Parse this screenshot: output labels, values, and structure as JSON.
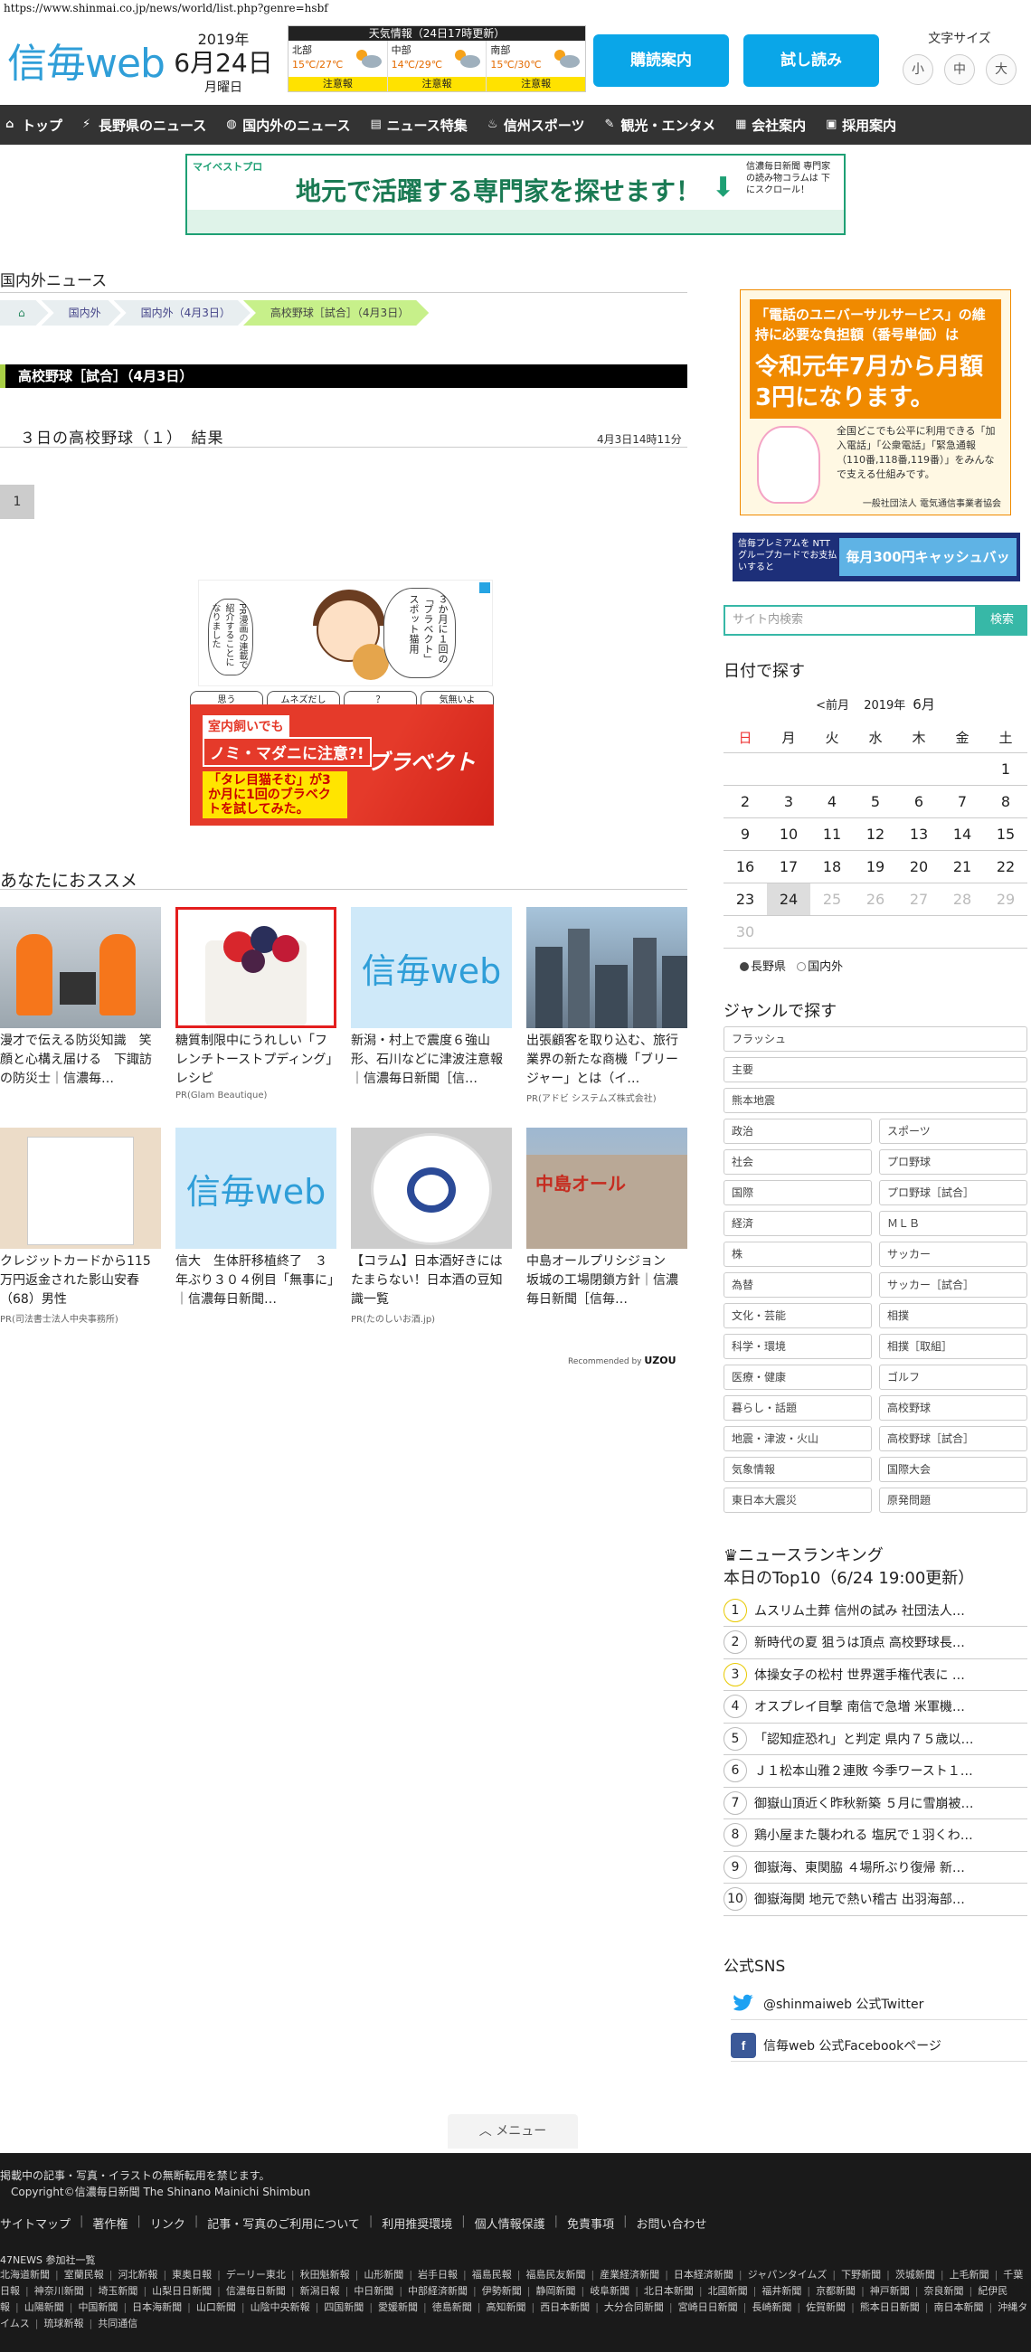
{
  "url": "https://www.shinmai.co.jp/news/world/list.php?genre=hsbf",
  "header": {
    "logo_text": "信毎web",
    "year": "2019年",
    "month_day": "6月24日",
    "weekday": "月曜日",
    "weather_title": "天気情報（24日17時更新）",
    "weather": [
      {
        "region": "北部",
        "temp": "15℃/27℃",
        "alert": "注意報"
      },
      {
        "region": "中部",
        "temp": "14℃/29℃",
        "alert": "注意報"
      },
      {
        "region": "南部",
        "temp": "15℃/30℃",
        "alert": "注意報"
      }
    ],
    "subscribe_label": "購読案内",
    "trial_label": "試し読み",
    "font_size_label": "文字サイズ",
    "font_small": "小",
    "font_medium": "中",
    "font_large": "大"
  },
  "nav": [
    {
      "icon": "home-icon",
      "glyph": "⌂",
      "label": "トップ"
    },
    {
      "icon": "lightning-icon",
      "glyph": "⚡",
      "label": "長野県のニュース"
    },
    {
      "icon": "globe-icon",
      "glyph": "◍",
      "label": "国内外のニュース"
    },
    {
      "icon": "document-icon",
      "glyph": "▤",
      "label": "ニュース特集"
    },
    {
      "icon": "sports-icon",
      "glyph": "♨",
      "label": "信州スポーツ"
    },
    {
      "icon": "tag-icon",
      "glyph": "✎",
      "label": "観光・エンタメ"
    },
    {
      "icon": "company-icon",
      "glyph": "▦",
      "label": "会社案内"
    },
    {
      "icon": "recruit-icon",
      "glyph": "▣",
      "label": "採用案内"
    }
  ],
  "top_banner": {
    "tag": "マイベストプロ",
    "headline": "地元で活躍する専門家を探せます！",
    "side": "信濃毎日新聞 専門家の読み物コラムは 下にスクロール！"
  },
  "main": {
    "section_title": "国内外ニュース",
    "breadcrumbs": [
      "国内外",
      "国内外（4月3日）",
      "高校野球［試合］（4月3日）"
    ],
    "category_bar": "高校野球［試合］（4月3日）",
    "article_title": "３日の高校野球（１）　結果",
    "article_time": "4月3日14時11分",
    "page": "1"
  },
  "ads": {
    "manga_right": "３か月に１回の「ブラベクト」スポット猫用",
    "manga_left": "PR漫画の連載で紹介することになりました",
    "strip": [
      "思う",
      "ムネズだし",
      "？",
      "気無いよ"
    ],
    "bravecto_1": "室内飼いでも",
    "bravecto_2": "ノミ・マダニに注意?!",
    "bravecto_3": "「タレ目猫そむ」が3か月に1回のブラベクトを試してみた。",
    "bravecto_logo": "ブラベクト"
  },
  "recommend": {
    "title": "あなたにおススメ",
    "cards": [
      {
        "text": "漫才で伝える防災知識　笑顔と心構え届ける　下諏訪の防災士｜信濃毎…",
        "pr": ""
      },
      {
        "text": "糖質制限中にうれしい「フレンチトーストプディング」レシピ",
        "pr": "PR(Glam Beautique)"
      },
      {
        "text": "新潟・村上で震度６強山形、石川などに津波注意報｜信濃毎日新聞［信…",
        "pr": ""
      },
      {
        "text": "出張顧客を取り込む、旅行業界の新たな商機「ブリージャー」とは（イ…",
        "pr": "PR(アドビ システムズ株式会社)"
      },
      {
        "text": "クレジットカードから115万円返金された影山安春（68）男性",
        "pr": "PR(司法書士法人中央事務所)"
      },
      {
        "text": "信大　生体肝移植終了　３年ぶり３０４例目「無事に」｜信濃毎日新聞…",
        "pr": ""
      },
      {
        "text": "【コラム】日本酒好きにはたまらない！日本酒の豆知識一覧",
        "pr": "PR(たのしいお酒.jp)"
      },
      {
        "text": "中島オールプリシジョン　坂城の工場閉鎖方針｜信濃毎日新聞［信毎…",
        "pr": ""
      }
    ],
    "sign_logo": "信毎web",
    "building_sign": "中島オール",
    "recommended_by": "Recommended by",
    "recommended_brand": "UZOU"
  },
  "sidebar": {
    "ad1_top": "「電話のユニバーサルサービス」の維持に必要な負担額（番号単価）は",
    "ad1_main": "令和元年7月から月額3円になります。",
    "ad1_body": "全国どこでも公平に利用できる「加入電話」「公衆電話」「緊急通報（110番,118番,119番）」をみんなで支える仕組みです。",
    "ad1_org": "一般社団法人 電気通信事業者協会",
    "ad2_left": "信毎プレミアムを NTTグループカードでお支払いすると",
    "ad2_right": "毎月300円キャッシュバック",
    "search_placeholder": "サイト内検索",
    "search_button": "検索",
    "calendar_title": "日付で探す",
    "prev_month": "<前月",
    "year_label": "2019年",
    "month_label": "6月",
    "weekdays": [
      "日",
      "月",
      "火",
      "水",
      "木",
      "金",
      "土"
    ],
    "weeks": [
      [
        "",
        "",
        "",
        "",
        "",
        "",
        "1"
      ],
      [
        "2",
        "3",
        "4",
        "5",
        "6",
        "7",
        "8"
      ],
      [
        "9",
        "10",
        "11",
        "12",
        "13",
        "14",
        "15"
      ],
      [
        "16",
        "17",
        "18",
        "19",
        "20",
        "21",
        "22"
      ],
      [
        "23",
        "24",
        "25",
        "26",
        "27",
        "28",
        "29"
      ],
      [
        "30",
        "",
        "",
        "",
        "",
        "",
        ""
      ]
    ],
    "radio_nagano": "長野県",
    "radio_world": "国内外",
    "genre_title": "ジャンルで探す",
    "genres_full": [
      "フラッシュ",
      "主要",
      "熊本地震"
    ],
    "genres_pairs": [
      [
        "政治",
        "スポーツ"
      ],
      [
        "社会",
        "プロ野球"
      ],
      [
        "国際",
        "プロ野球［試合］"
      ],
      [
        "経済",
        "ＭＬＢ"
      ],
      [
        "株",
        "サッカー"
      ],
      [
        "為替",
        "サッカー［試合］"
      ],
      [
        "文化・芸能",
        "相撲"
      ],
      [
        "科学・環境",
        "相撲［取組］"
      ],
      [
        "医療・健康",
        "ゴルフ"
      ],
      [
        "暮らし・話題",
        "高校野球"
      ],
      [
        "地震・津波・火山",
        "高校野球［試合］"
      ],
      [
        "気象情報",
        "国際大会"
      ],
      [
        "東日本大震災",
        "原発問題"
      ]
    ],
    "ranking_title": "ニュースランキング",
    "ranking_sub": "本日のTop10（6/24 19:00更新）",
    "ranking": [
      "ムスリム土葬 信州の試み 社団法人…",
      "新時代の夏 狙うは頂点 高校野球長…",
      "体操女子の松村 世界選手権代表に …",
      "オスプレイ目撃 南信で急増 米軍機…",
      "「認知症恐れ」と判定 県内７５歳以…",
      "Ｊ１松本山雅２連敗 今季ワースト１…",
      "御嶽山頂近く昨秋新築 ５月に雪崩被…",
      "鶏小屋また襲われる 塩尻で１羽くわ…",
      "御嶽海、東関脇 ４場所ぶり復帰 新…",
      "御嶽海関 地元で熱い稽古 出羽海部…"
    ],
    "sns_title": "公式SNS",
    "twitter": "@shinmaiweb 公式Twitter",
    "facebook": "信毎web 公式Facebookページ"
  },
  "menu_label": "メニュー",
  "footer": {
    "copy1": "掲載中の記事・写真・イラストの無断転用を禁じます。",
    "copy2": "Copyright©信濃毎日新聞 The Shinano Mainichi Shimbun",
    "links": [
      "サイトマップ",
      "著作権",
      "リンク",
      "記事・写真のご利用について",
      "利用推奨環境",
      "個人情報保護",
      "免責事項",
      "お問い合わせ"
    ],
    "partners_title": "47NEWS 参加社一覧",
    "partners": [
      "北海道新聞",
      "室蘭民報",
      "河北新報",
      "東奥日報",
      "デーリー東北",
      "秋田魁新報",
      "山形新聞",
      "岩手日報",
      "福島民報",
      "福島民友新聞",
      "産業経済新聞",
      "日本経済新聞",
      "ジャパンタイムズ",
      "下野新聞",
      "茨城新聞",
      "上毛新聞",
      "千葉日報",
      "神奈川新聞",
      "埼玉新聞",
      "山梨日日新聞",
      "信濃毎日新聞",
      "新潟日報",
      "中日新聞",
      "中部経済新聞",
      "伊勢新聞",
      "静岡新聞",
      "岐阜新聞",
      "北日本新聞",
      "北國新聞",
      "福井新聞",
      "京都新聞",
      "神戸新聞",
      "奈良新聞",
      "紀伊民報",
      "山陽新聞",
      "中国新聞",
      "日本海新聞",
      "山口新聞",
      "山陰中央新報",
      "四国新聞",
      "愛媛新聞",
      "徳島新聞",
      "高知新聞",
      "西日本新聞",
      "大分合同新聞",
      "宮崎日日新聞",
      "長崎新聞",
      "佐賀新聞",
      "熊本日日新聞",
      "南日本新聞",
      "沖縄タイムス",
      "琉球新報",
      "共同通信"
    ]
  }
}
